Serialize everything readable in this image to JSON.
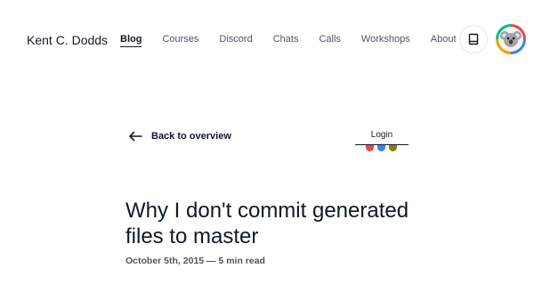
{
  "nav": {
    "brand": "Kent C. Dodds",
    "links": [
      {
        "label": "Blog",
        "active": true
      },
      {
        "label": "Courses",
        "active": false
      },
      {
        "label": "Discord",
        "active": false
      },
      {
        "label": "Chats",
        "active": false
      },
      {
        "label": "Calls",
        "active": false
      },
      {
        "label": "Workshops",
        "active": false
      },
      {
        "label": "About",
        "active": false
      }
    ],
    "theme_icon": "theme-toggle-icon",
    "avatar_icon": "koala-avatar"
  },
  "back_link": {
    "label": "Back to overview",
    "icon": "arrow-left-icon"
  },
  "login": {
    "label": "Login",
    "team_colors": [
      "#ef4444",
      "#3b82f6",
      "#8b7d0a"
    ]
  },
  "post": {
    "title": "Why I don't commit generated files to master",
    "meta": "October 5th, 2015 — 5 min read"
  }
}
